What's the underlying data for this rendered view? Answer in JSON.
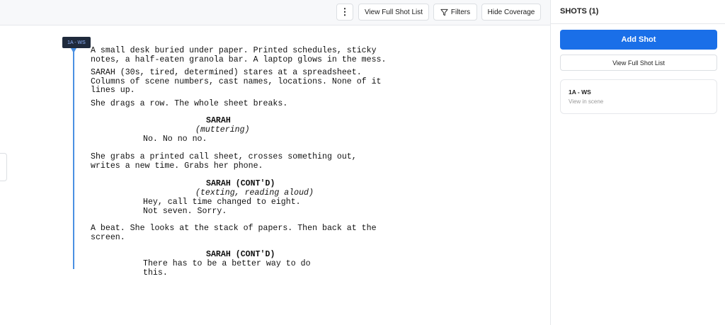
{
  "toolbar": {
    "more_label": "⋮",
    "view_full_shot_list": "View Full Shot List",
    "filters": "Filters",
    "hide_coverage": "Hide Coverage"
  },
  "shot_marker": {
    "label": "1A - WS"
  },
  "script": {
    "action1": "A small desk buried under paper. Printed schedules, sticky\nnotes, a half-eaten granola bar. A laptop glows in the mess.",
    "action2": "SARAH (30s, tired, determined) stares at a spreadsheet.\nColumns of scene numbers, cast names, locations. None of it\nlines up.",
    "action3": "She drags a row. The whole sheet breaks.",
    "char1": "SARAH",
    "paren1": "(muttering)",
    "dialog1": "No. No no no.",
    "action4": "She grabs a printed call sheet, crosses something out,\nwrites a new time. Grabs her phone.",
    "char2": "SARAH (CONT'D)",
    "paren2": "(texting, reading aloud)",
    "dialog2": "Hey, call time changed to eight.\nNot seven. Sorry.",
    "action5": "A beat. She looks at the stack of papers. Then back at the\nscreen.",
    "char3": "SARAH (CONT'D)",
    "dialog3": "There has to be a better way to do\nthis."
  },
  "sidebar": {
    "header": "SHOTS (1)",
    "add_shot": "Add Shot",
    "view_full_shot_list": "View Full Shot List",
    "shots": [
      {
        "title": "1A - WS",
        "subtitle": "View in scene"
      }
    ]
  },
  "colors": {
    "accent": "#1a6fe8",
    "marker_line": "#4a90e2",
    "marker_tag_bg": "#1f2a3c"
  }
}
